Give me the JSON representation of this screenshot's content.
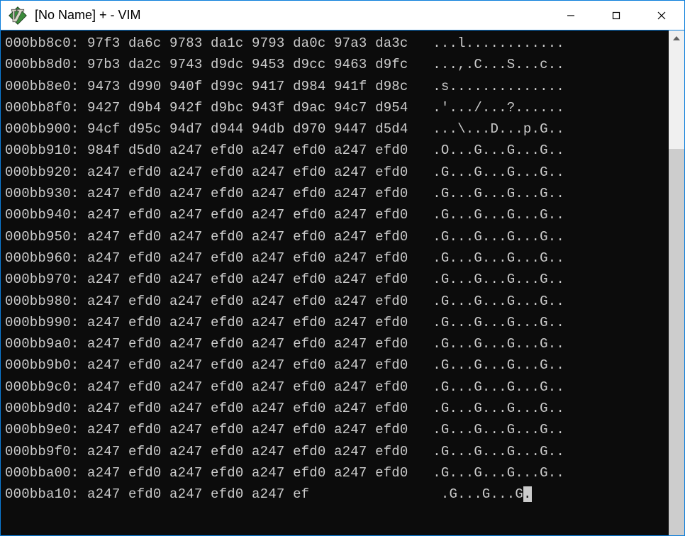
{
  "window": {
    "title": "[No Name] + - VIM"
  },
  "hexdump": {
    "rows": [
      {
        "addr": "000bb8c0:",
        "hex": "97f3 da6c 9783 da1c 9793 da0c 97a3 da3c",
        "ascii": "...l............"
      },
      {
        "addr": "000bb8d0:",
        "hex": "97b3 da2c 9743 d9dc 9453 d9cc 9463 d9fc",
        "ascii": "...,.C...S...c.."
      },
      {
        "addr": "000bb8e0:",
        "hex": "9473 d990 940f d99c 9417 d984 941f d98c",
        "ascii": ".s.............."
      },
      {
        "addr": "000bb8f0:",
        "hex": "9427 d9b4 942f d9bc 943f d9ac 94c7 d954",
        "ascii": ".'.../...?......"
      },
      {
        "addr": "000bb900:",
        "hex": "94cf d95c 94d7 d944 94db d970 9447 d5d4",
        "ascii": "...\\...D...p.G.."
      },
      {
        "addr": "000bb910:",
        "hex": "984f d5d0 a247 efd0 a247 efd0 a247 efd0",
        "ascii": ".O...G...G...G.."
      },
      {
        "addr": "000bb920:",
        "hex": "a247 efd0 a247 efd0 a247 efd0 a247 efd0",
        "ascii": ".G...G...G...G.."
      },
      {
        "addr": "000bb930:",
        "hex": "a247 efd0 a247 efd0 a247 efd0 a247 efd0",
        "ascii": ".G...G...G...G.."
      },
      {
        "addr": "000bb940:",
        "hex": "a247 efd0 a247 efd0 a247 efd0 a247 efd0",
        "ascii": ".G...G...G...G.."
      },
      {
        "addr": "000bb950:",
        "hex": "a247 efd0 a247 efd0 a247 efd0 a247 efd0",
        "ascii": ".G...G...G...G.."
      },
      {
        "addr": "000bb960:",
        "hex": "a247 efd0 a247 efd0 a247 efd0 a247 efd0",
        "ascii": ".G...G...G...G.."
      },
      {
        "addr": "000bb970:",
        "hex": "a247 efd0 a247 efd0 a247 efd0 a247 efd0",
        "ascii": ".G...G...G...G.."
      },
      {
        "addr": "000bb980:",
        "hex": "a247 efd0 a247 efd0 a247 efd0 a247 efd0",
        "ascii": ".G...G...G...G.."
      },
      {
        "addr": "000bb990:",
        "hex": "a247 efd0 a247 efd0 a247 efd0 a247 efd0",
        "ascii": ".G...G...G...G.."
      },
      {
        "addr": "000bb9a0:",
        "hex": "a247 efd0 a247 efd0 a247 efd0 a247 efd0",
        "ascii": ".G...G...G...G.."
      },
      {
        "addr": "000bb9b0:",
        "hex": "a247 efd0 a247 efd0 a247 efd0 a247 efd0",
        "ascii": ".G...G...G...G.."
      },
      {
        "addr": "000bb9c0:",
        "hex": "a247 efd0 a247 efd0 a247 efd0 a247 efd0",
        "ascii": ".G...G...G...G.."
      },
      {
        "addr": "000bb9d0:",
        "hex": "a247 efd0 a247 efd0 a247 efd0 a247 efd0",
        "ascii": ".G...G...G...G.."
      },
      {
        "addr": "000bb9e0:",
        "hex": "a247 efd0 a247 efd0 a247 efd0 a247 efd0",
        "ascii": ".G...G...G...G.."
      },
      {
        "addr": "000bb9f0:",
        "hex": "a247 efd0 a247 efd0 a247 efd0 a247 efd0",
        "ascii": ".G...G...G...G.."
      },
      {
        "addr": "000bba00:",
        "hex": "a247 efd0 a247 efd0 a247 efd0 a247 efd0",
        "ascii": ".G...G...G...G.."
      },
      {
        "addr": "000bba10:",
        "hex": "a247 efd0 a247 efd0 a247 ef             ",
        "ascii": ".G...G...G."
      }
    ]
  }
}
